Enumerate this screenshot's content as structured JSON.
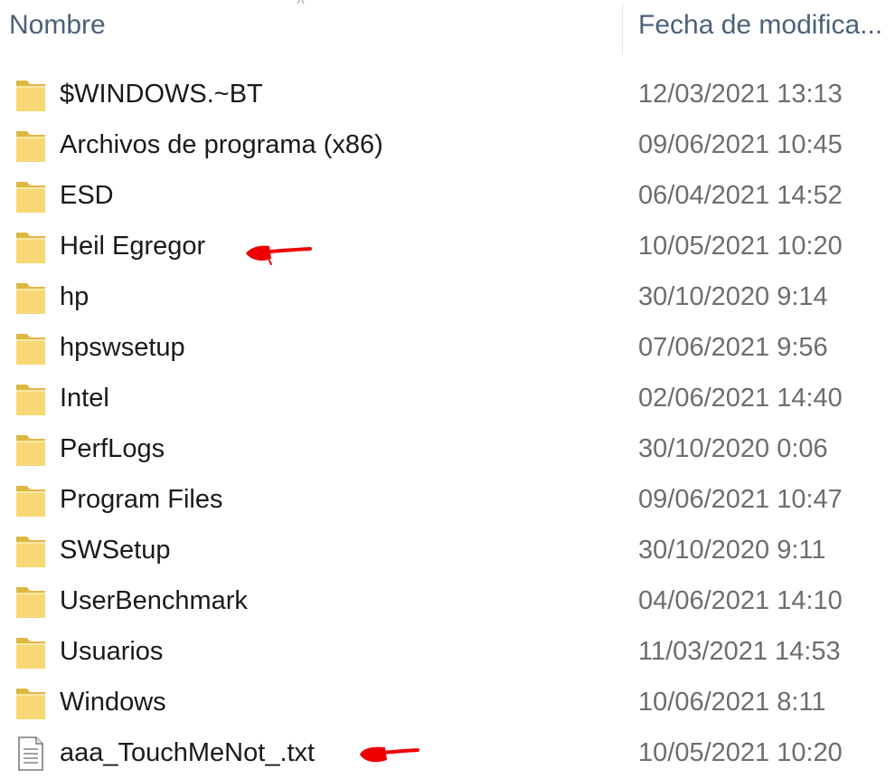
{
  "header": {
    "name_label": "Nombre",
    "date_label": "Fecha de modifica..."
  },
  "colors": {
    "folder": "#f8d775",
    "folder_dark": "#e0b840",
    "annotation": "#ee0000"
  },
  "files": [
    {
      "name": "$WINDOWS.~BT",
      "date": "12/03/2021 13:13",
      "type": "folder",
      "icon": "folder-icon"
    },
    {
      "name": "Archivos de programa (x86)",
      "date": "09/06/2021 10:45",
      "type": "folder",
      "icon": "folder-icon"
    },
    {
      "name": "ESD",
      "date": "06/04/2021 14:52",
      "type": "folder",
      "icon": "folder-icon"
    },
    {
      "name": "Heil Egregor",
      "date": "10/05/2021 10:20",
      "type": "folder",
      "icon": "folder-icon",
      "marked": true
    },
    {
      "name": "hp",
      "date": "30/10/2020 9:14",
      "type": "folder",
      "icon": "folder-icon"
    },
    {
      "name": "hpswsetup",
      "date": "07/06/2021 9:56",
      "type": "folder",
      "icon": "folder-icon"
    },
    {
      "name": "Intel",
      "date": "02/06/2021 14:40",
      "type": "folder",
      "icon": "folder-icon"
    },
    {
      "name": "PerfLogs",
      "date": "30/10/2020 0:06",
      "type": "folder",
      "icon": "folder-icon"
    },
    {
      "name": "Program Files",
      "date": "09/06/2021 10:47",
      "type": "folder",
      "icon": "folder-icon"
    },
    {
      "name": "SWSetup",
      "date": "30/10/2020 9:11",
      "type": "folder",
      "icon": "folder-icon"
    },
    {
      "name": "UserBenchmark",
      "date": "04/06/2021 14:10",
      "type": "folder",
      "icon": "folder-icon"
    },
    {
      "name": "Usuarios",
      "date": "11/03/2021 14:53",
      "type": "folder",
      "icon": "folder-icon"
    },
    {
      "name": "Windows",
      "date": "10/06/2021 8:11",
      "type": "folder",
      "icon": "folder-icon"
    },
    {
      "name": "aaa_TouchMeNot_.txt",
      "date": "10/05/2021 10:20",
      "type": "text-file",
      "icon": "text-file-icon",
      "marked": true
    }
  ]
}
